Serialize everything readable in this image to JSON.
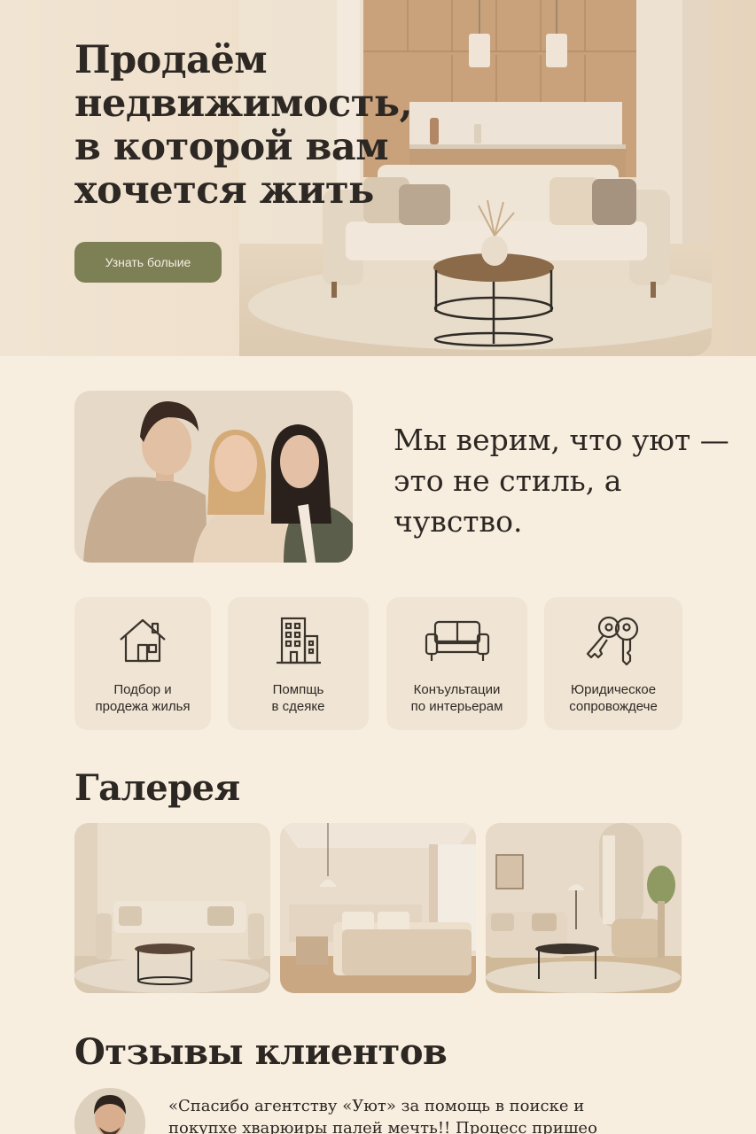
{
  "hero": {
    "title": "Продаём недвижимость, в которой вам хочется жить",
    "button_label": "Узнать болыие"
  },
  "about": {
    "quote": "Мы верим, что уют — это не стиль, а чувство."
  },
  "services": [
    {
      "icon": "house-icon",
      "label": "Подбор и\nпродежа жилья"
    },
    {
      "icon": "building-icon",
      "label": "Помпщь\nв сдеяке"
    },
    {
      "icon": "sofa-icon",
      "label": "Конъультации\nпо интерьерам"
    },
    {
      "icon": "keys-icon",
      "label": "Юридическое\nсопровождечe"
    }
  ],
  "gallery": {
    "title": "Галерея",
    "items": [
      "living-room-photo",
      "bedroom-photo",
      "lounge-photo"
    ]
  },
  "reviews": {
    "title": "Отзывы клиентов",
    "text": "«Спасибо агентству «Уют» за помощь в поиске и покупхе хварюиры палей мечть!! Процесс пришео"
  },
  "colors": {
    "background": "#f8eedf",
    "accent": "#7d7f55",
    "card": "#f0e5d4",
    "text": "#2c2722"
  }
}
